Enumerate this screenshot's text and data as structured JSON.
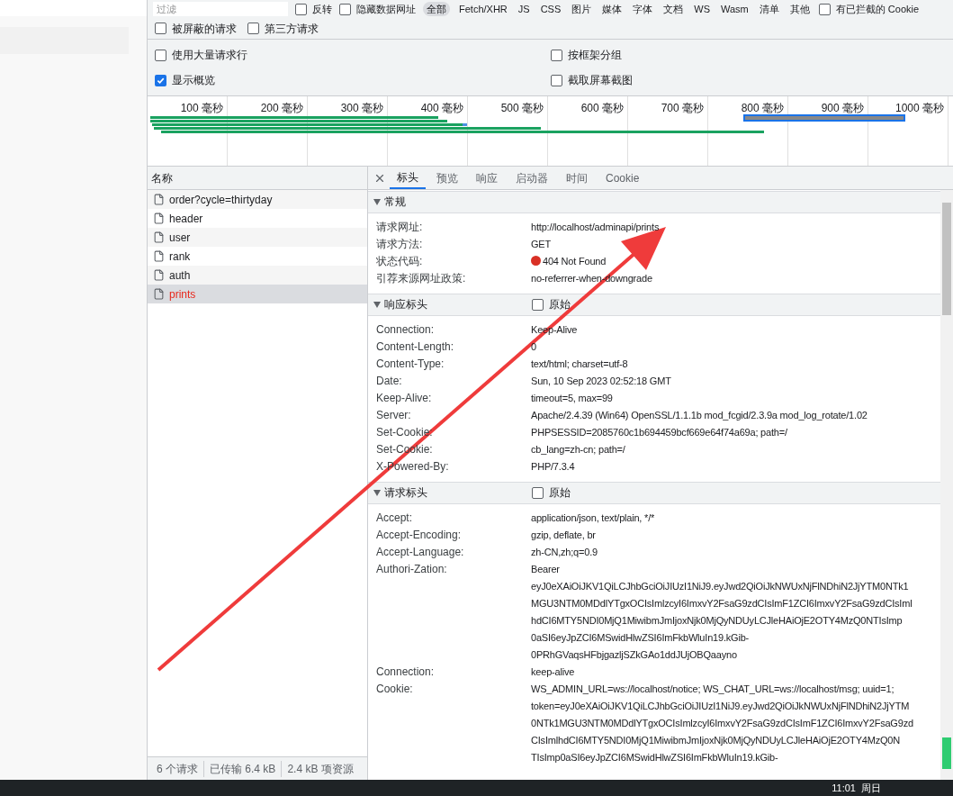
{
  "filter_bar": {
    "placeholder": "过滤",
    "options": [
      {
        "label": "反转",
        "checked": false
      },
      {
        "label": "隐藏数据网址",
        "checked": false
      }
    ],
    "types": [
      {
        "label": "全部",
        "selected": true
      },
      {
        "label": "Fetch/XHR",
        "selected": false
      },
      {
        "label": "JS",
        "selected": false
      },
      {
        "label": "CSS",
        "selected": false
      },
      {
        "label": "图片",
        "selected": false
      },
      {
        "label": "媒体",
        "selected": false
      },
      {
        "label": "字体",
        "selected": false
      },
      {
        "label": "文档",
        "selected": false
      },
      {
        "label": "WS",
        "selected": false
      },
      {
        "label": "Wasm",
        "selected": false
      },
      {
        "label": "清单",
        "selected": false
      },
      {
        "label": "其他",
        "selected": false
      }
    ],
    "blocked_cookies": {
      "label": "有已拦截的 Cookie",
      "checked": false
    }
  },
  "filter_row2": [
    {
      "label": "被屏蔽的请求",
      "checked": false
    },
    {
      "label": "第三方请求",
      "checked": false
    }
  ],
  "settings": [
    {
      "label": "使用大量请求行",
      "checked": false
    },
    {
      "label": "按框架分组",
      "checked": false
    },
    {
      "label": "显示概览",
      "checked": true
    },
    {
      "label": "截取屏幕截图",
      "checked": false
    }
  ],
  "overview": {
    "ticks": [
      "100 毫秒",
      "200 毫秒",
      "300 毫秒",
      "400 毫秒",
      "500 毫秒",
      "600 毫秒",
      "700 毫秒",
      "800 毫秒",
      "900 毫秒",
      "1000 毫秒"
    ]
  },
  "requests": {
    "header": "名称",
    "items": [
      {
        "name": "order?cycle=thirtyday",
        "selected": false,
        "error": false
      },
      {
        "name": "header",
        "selected": false,
        "error": false
      },
      {
        "name": "user",
        "selected": false,
        "error": false
      },
      {
        "name": "rank",
        "selected": false,
        "error": false
      },
      {
        "name": "auth",
        "selected": false,
        "error": false
      },
      {
        "name": "prints",
        "selected": true,
        "error": true
      }
    ]
  },
  "details": {
    "tabs": [
      {
        "label": "标头",
        "selected": true
      },
      {
        "label": "预览",
        "selected": false
      },
      {
        "label": "响应",
        "selected": false
      },
      {
        "label": "启动器",
        "selected": false
      },
      {
        "label": "时间",
        "selected": false
      },
      {
        "label": "Cookie",
        "selected": false
      }
    ],
    "sections": [
      {
        "title": "常规",
        "expanded": true,
        "rows": [
          {
            "kind": "text",
            "name": "请求网址:",
            "lines": [
              "http://localhost/adminapi/prints"
            ]
          },
          {
            "kind": "text",
            "name": "请求方法:",
            "lines": [
              "GET"
            ]
          },
          {
            "kind": "status",
            "name": "状态代码:",
            "color": "#d93025",
            "lines": [
              "404 Not Found"
            ]
          },
          {
            "kind": "text",
            "name": "引荐来源网址政策:",
            "lines": [
              "no-referrer-when-downgrade"
            ]
          }
        ]
      },
      {
        "title": "响应标头",
        "expanded": true,
        "raw": {
          "label": "原始",
          "checked": false
        },
        "rows": [
          {
            "kind": "text",
            "name": "Connection:",
            "lines": [
              "Keep-Alive"
            ]
          },
          {
            "kind": "text",
            "name": "Content-Length:",
            "lines": [
              "0"
            ]
          },
          {
            "kind": "text",
            "name": "Content-Type:",
            "lines": [
              "text/html; charset=utf-8"
            ]
          },
          {
            "kind": "text",
            "name": "Date:",
            "lines": [
              "Sun, 10 Sep 2023 02:52:18 GMT"
            ]
          },
          {
            "kind": "text",
            "name": "Keep-Alive:",
            "lines": [
              "timeout=5, max=99"
            ]
          },
          {
            "kind": "text",
            "name": "Server:",
            "lines": [
              "Apache/2.4.39 (Win64) OpenSSL/1.1.1b mod_fcgid/2.3.9a mod_log_rotate/1.02"
            ]
          },
          {
            "kind": "text",
            "name": "Set-Cookie:",
            "lines": [
              "PHPSESSID=2085760c1b694459bcf669e64f74a69a; path=/"
            ]
          },
          {
            "kind": "text",
            "name": "Set-Cookie:",
            "lines": [
              "cb_lang=zh-cn; path=/"
            ]
          },
          {
            "kind": "text",
            "name": "X-Powered-By:",
            "lines": [
              "PHP/7.3.4"
            ]
          }
        ]
      },
      {
        "title": "请求标头",
        "expanded": true,
        "raw": {
          "label": "原始",
          "checked": false
        },
        "rows": [
          {
            "kind": "text",
            "name": "Accept:",
            "lines": [
              "application/json, text/plain, */*"
            ]
          },
          {
            "kind": "text",
            "name": "Accept-Encoding:",
            "lines": [
              "gzip, deflate, br"
            ]
          },
          {
            "kind": "text",
            "name": "Accept-Language:",
            "lines": [
              "zh-CN,zh;q=0.9"
            ]
          },
          {
            "kind": "text",
            "name": "Authori-Zation:",
            "lines": [
              "Bearer",
              "eyJ0eXAiOiJKV1QiLCJhbGciOiJIUzI1NiJ9.eyJwd2QiOiJkNWUxNjFlNDhiN2JjYTM0NTk1",
              "MGU3NTM0MDdlYTgxOCIsImlzcyI6ImxvY2FsaG9zdCIsImF1ZCI6ImxvY2FsaG9zdCIsIml",
              "hdCI6MTY5NDI0MjQ1MiwibmJmIjoxNjk0MjQyNDUyLCJleHAiOjE2OTY4MzQ0NTIsImp",
              "0aSI6eyJpZCI6MSwidHlwZSI6ImFkbWluIn19.kGib-",
              "0PRhGVaqsHFbjgazljSZkGAo1ddJUjOBQaayno"
            ]
          },
          {
            "kind": "text",
            "name": "Connection:",
            "lines": [
              "keep-alive"
            ]
          },
          {
            "kind": "text",
            "name": "Cookie:",
            "lines": [
              "WS_ADMIN_URL=ws://localhost/notice; WS_CHAT_URL=ws://localhost/msg; uuid=1;",
              "token=eyJ0eXAiOiJKV1QiLCJhbGciOiJIUzI1NiJ9.eyJwd2QiOiJkNWUxNjFlNDhiN2JjYTM",
              "0NTk1MGU3NTM0MDdlYTgxOCIsImlzcyI6ImxvY2FsaG9zdCIsImF1ZCI6ImxvY2FsaG9zd",
              "CIsImlhdCI6MTY5NDI0MjQ1MiwibmJmIjoxNjk0MjQyNDUyLCJleHAiOjE2OTY4MzQ0N",
              "TIsImp0aSI6eyJpZCI6MSwidHlwZSI6ImFkbWluIn19.kGib-"
            ]
          }
        ]
      }
    ]
  },
  "status_bar": [
    "6 个请求",
    "已传输 6.4 kB",
    "2.4 kB 项资源"
  ],
  "taskbar": {
    "time": "11:01",
    "day": "周日"
  }
}
